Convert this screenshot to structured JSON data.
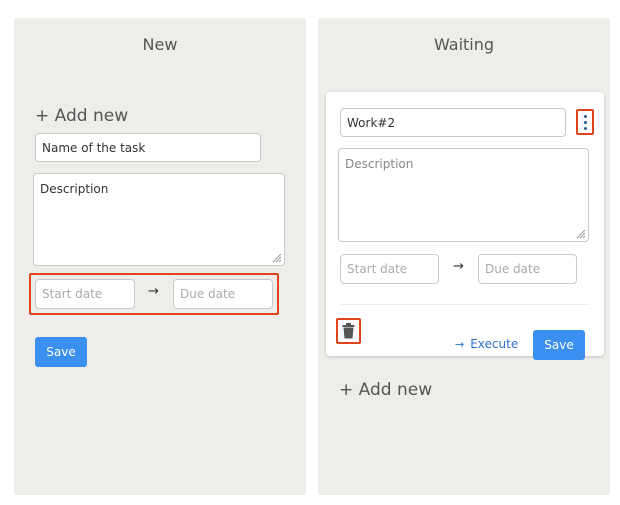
{
  "columns": {
    "new": {
      "title": "New",
      "add_new_label": "+ Add new",
      "task_name_placeholder": "Name of the task",
      "description_text": "Description",
      "start_date_placeholder": "Start date",
      "arrow": "→",
      "due_date_placeholder": "Due date",
      "save_label": "Save"
    },
    "waiting": {
      "title": "Waiting",
      "card": {
        "task_name_value": "Work#2",
        "description_placeholder": "Description",
        "start_date_placeholder": "Start date",
        "arrow": "→",
        "due_date_placeholder": "Due date",
        "execute_label": "Execute",
        "save_label": "Save"
      },
      "add_new_label": "+ Add new"
    }
  },
  "colors": {
    "accent": "#3b8ff0",
    "highlight": "#e0441c",
    "column_bg": "#eeedea",
    "link": "#2a73c9"
  },
  "icons": [
    "kebab-menu-icon",
    "trash-icon",
    "arrow-right-icon",
    "resize-grip-icon"
  ]
}
